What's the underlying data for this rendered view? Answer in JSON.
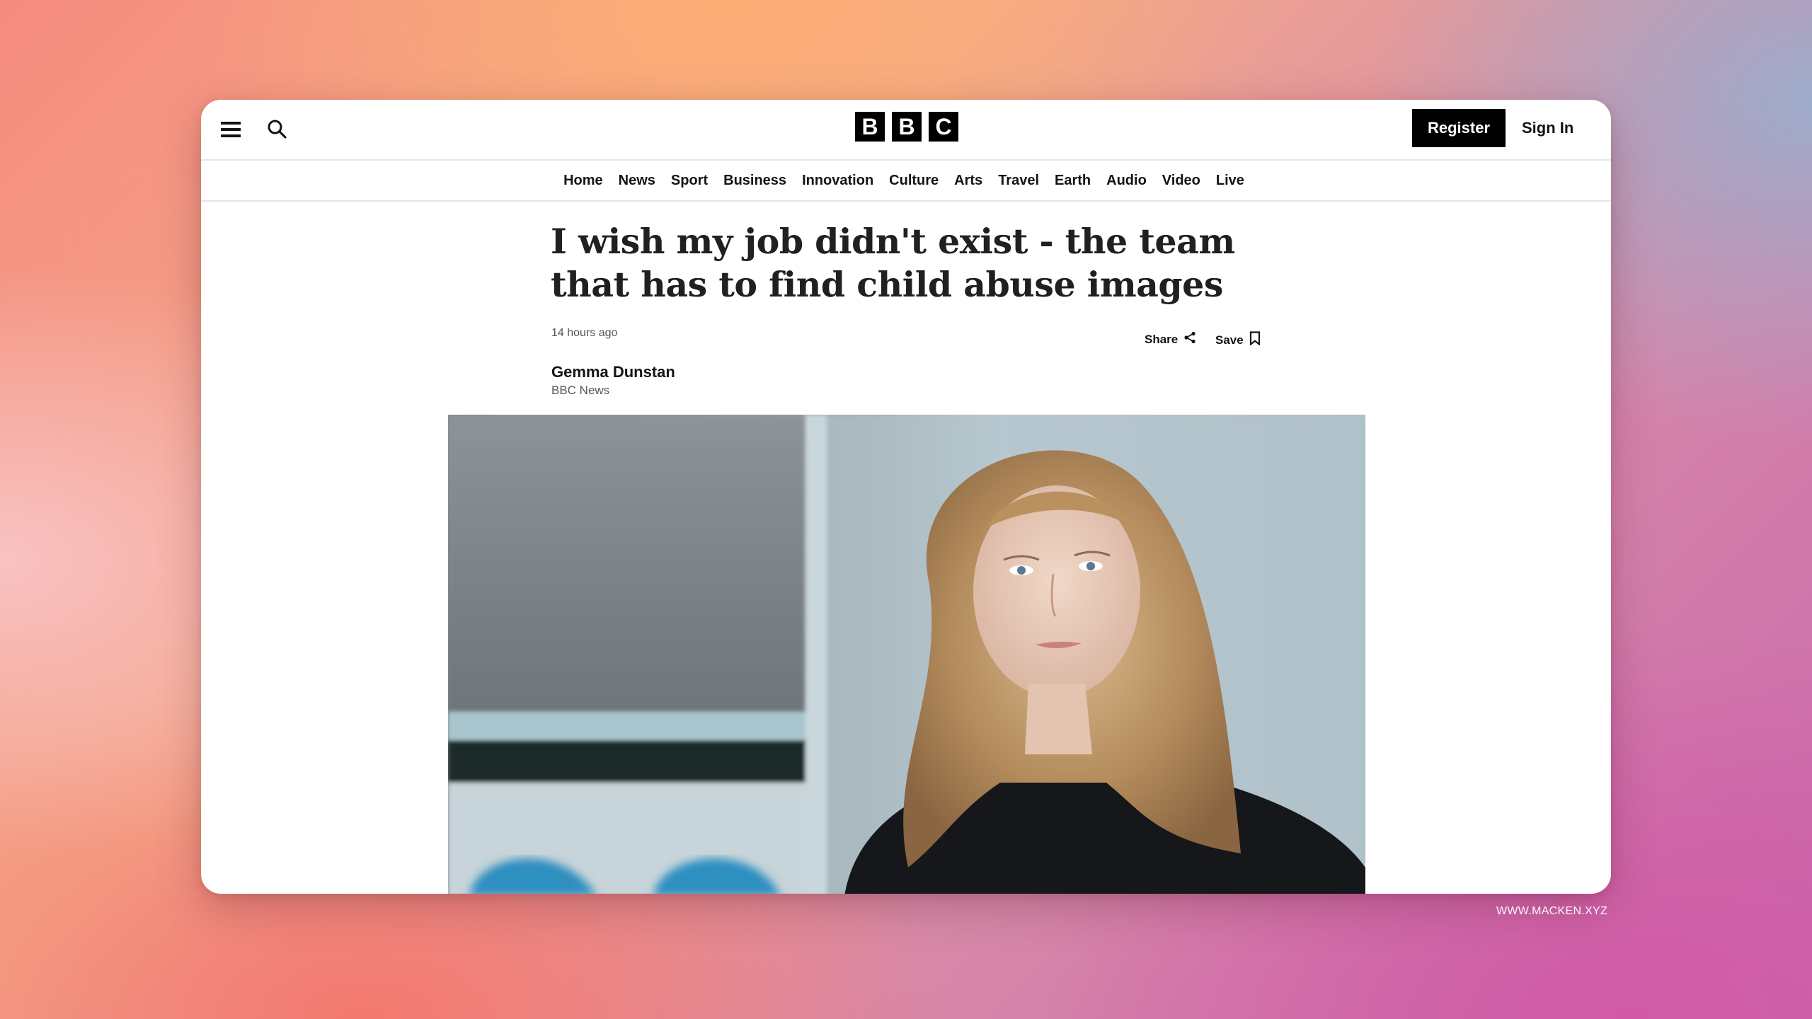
{
  "header": {
    "menu_icon": "hamburger-menu-icon",
    "search_icon": "search-icon",
    "logo_letters": [
      "B",
      "B",
      "C"
    ],
    "register_label": "Register",
    "signin_label": "Sign In"
  },
  "nav": {
    "items": [
      "Home",
      "News",
      "Sport",
      "Business",
      "Innovation",
      "Culture",
      "Arts",
      "Travel",
      "Earth",
      "Audio",
      "Video",
      "Live"
    ]
  },
  "article": {
    "headline": "I wish my job didn't exist - the team that has to find child abuse images",
    "timestamp": "14 hours ago",
    "share_label": "Share",
    "save_label": "Save",
    "author_name": "Gemma Dunstan",
    "author_org": "BBC News"
  },
  "watermark": "WWW.MACKEN.XYZ",
  "colors": {
    "brand_black": "#000000",
    "text_primary": "#141414",
    "text_secondary": "#545658",
    "divider": "#e6e6e6"
  }
}
